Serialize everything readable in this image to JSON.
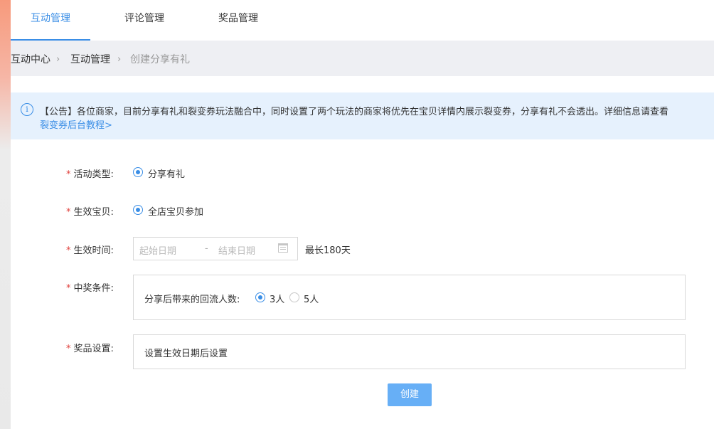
{
  "tabs": [
    {
      "label": "互动管理",
      "active": true
    },
    {
      "label": "评论管理",
      "active": false
    },
    {
      "label": "奖品管理",
      "active": false
    }
  ],
  "breadcrumb": [
    "互动中心",
    "互动管理",
    "创建分享有礼"
  ],
  "notice": {
    "text": "【公告】各位商家，目前分享有礼和裂变券玩法融合中，同时设置了两个玩法的商家将优先在宝贝详情内展示裂变券，分享有礼不会透出。详细信息请查看",
    "link": "裂变券后台教程>"
  },
  "form": {
    "activity_type": {
      "label": "活动类型:",
      "option": "分享有礼"
    },
    "items": {
      "label": "生效宝贝:",
      "option": "全店宝贝参加"
    },
    "time": {
      "label": "生效时间:",
      "start_placeholder": "起始日期",
      "separator": "-",
      "end_placeholder": "结束日期",
      "hint": "最长180天"
    },
    "condition": {
      "label": "中奖条件:",
      "text": "分享后带来的回流人数:",
      "options": [
        "3人",
        "5人"
      ],
      "selected": "3人"
    },
    "prize": {
      "label": "奖品设置:",
      "text": "设置生效日期后设置"
    }
  },
  "submit_label": "创建",
  "colors": {
    "accent": "#3a8ee6",
    "required": "#e0403c",
    "button": "#67aff6",
    "notice_bg": "#e6f1fd"
  }
}
